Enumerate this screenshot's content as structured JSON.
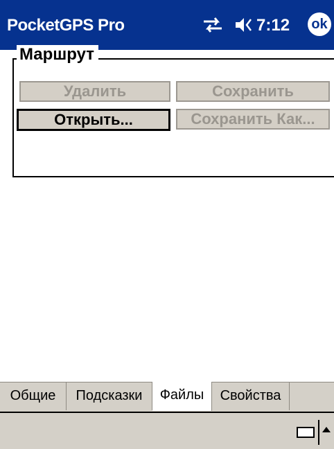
{
  "titlebar": {
    "title": "PocketGPS Pro",
    "time": "7:12",
    "ok_label": "ok"
  },
  "route_group": {
    "legend": "Маршрут",
    "delete_label": "Удалить",
    "save_label": "Сохранить",
    "open_label": "Открыть...",
    "save_as_label": "Сохранить Как..."
  },
  "tabs": [
    {
      "label": "Общие",
      "active": false
    },
    {
      "label": "Подсказки",
      "active": false
    },
    {
      "label": "Файлы",
      "active": true
    },
    {
      "label": "Свойства",
      "active": false
    }
  ],
  "menubar": {
    "icons": [
      "keyboard-icon",
      "sip-arrow-icon"
    ]
  },
  "colors": {
    "titlebar": "#06328f",
    "panel": "#d4d0c8",
    "disabled_text": "#9a968f"
  }
}
